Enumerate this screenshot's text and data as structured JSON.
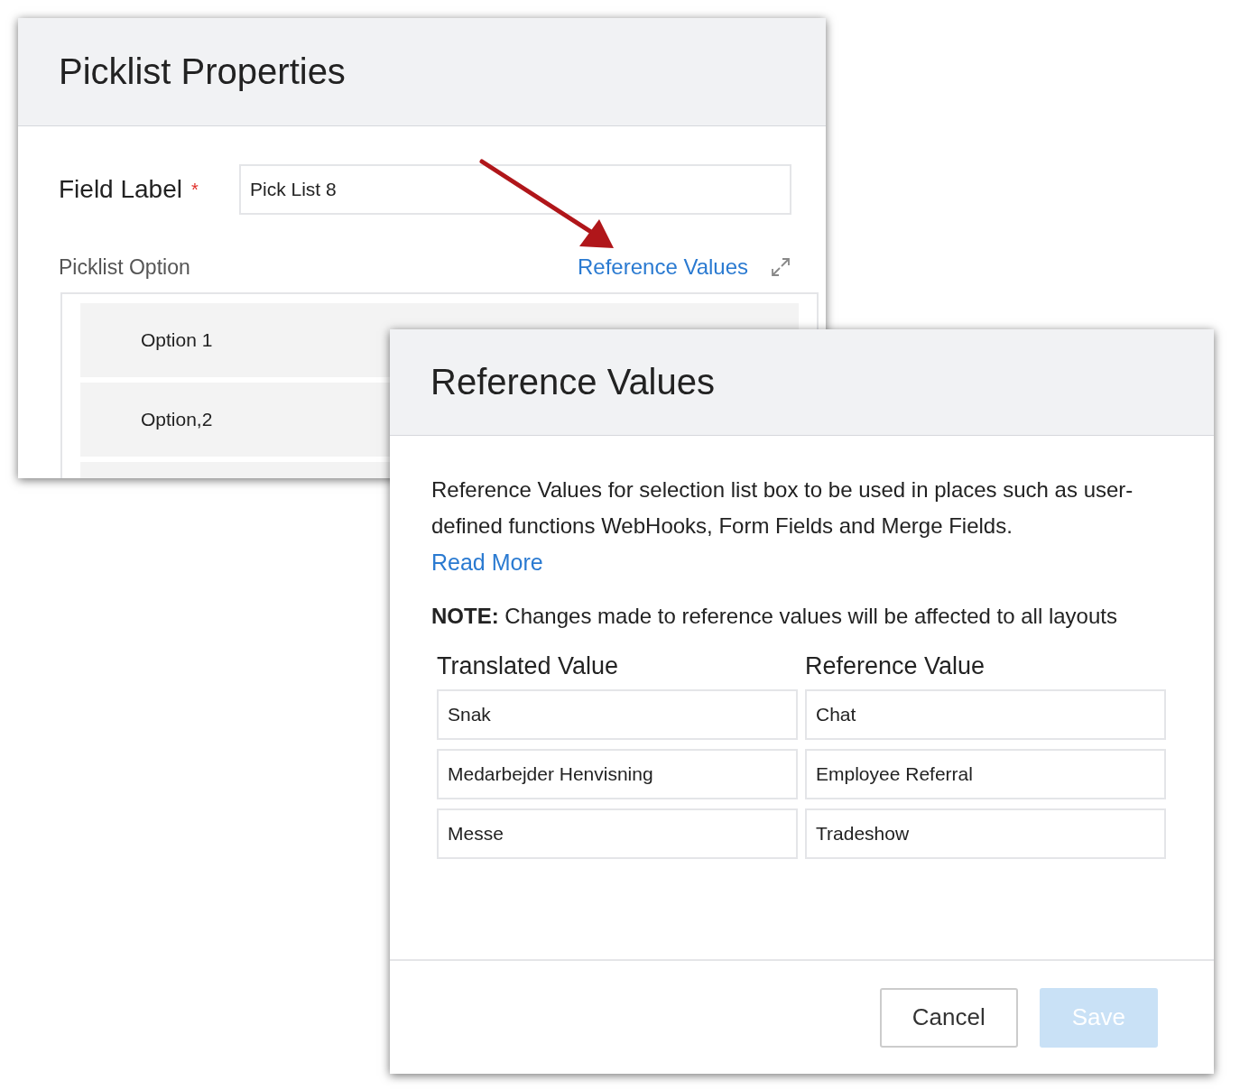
{
  "back_dialog": {
    "title": "Picklist Properties",
    "field_label": {
      "label": "Field Label",
      "required": true,
      "required_mark": "*",
      "value": "Pick List 8"
    },
    "options_label": "Picklist Option",
    "reference_link": "Reference Values",
    "options": [
      "Option 1",
      "Option,2"
    ]
  },
  "dialog": {
    "title": "Reference Values",
    "description": "Reference Values for selection list box to be used in places such as user-defined functions WebHooks, Form Fields and Merge Fields.",
    "read_more": "Read More",
    "note": "**NOTE:** Changes made to reference values will be affected to all layouts",
    "columns": [
      "Translated Value",
      "Reference Value"
    ],
    "rows": [
      [
        "Snak",
        "Chat"
      ],
      [
        "Medarbejder Henvisning",
        "Employee Referral"
      ],
      [
        "Messe",
        "Tradeshow"
      ]
    ],
    "buttons": [
      {
        "label": "Cancel",
        "kind": "secondary",
        "disabled": false
      },
      {
        "label": "Save",
        "kind": "primary",
        "disabled": true
      }
    ]
  }
}
